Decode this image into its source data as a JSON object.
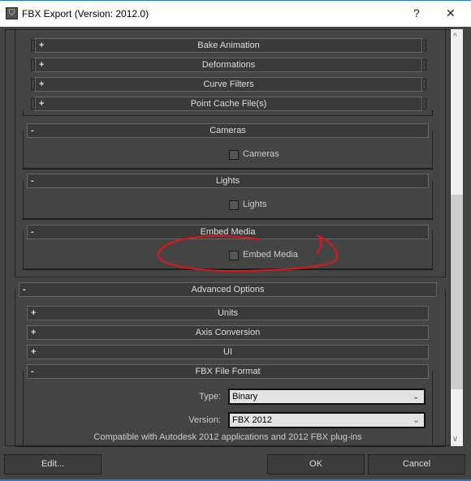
{
  "window": {
    "title": "FBX Export (Version: 2012.0)",
    "help": "?",
    "close": "✕"
  },
  "collapsed_rollouts": [
    {
      "label": "Bake Animation",
      "sign": "+"
    },
    {
      "label": "Deformations",
      "sign": "+"
    },
    {
      "label": "Curve Filters",
      "sign": "+"
    },
    {
      "label": "Point Cache File(s)",
      "sign": "+"
    }
  ],
  "cameras": {
    "header": "Cameras",
    "sign": "-",
    "checkbox_label": "Cameras",
    "checked": false
  },
  "lights": {
    "header": "Lights",
    "sign": "-",
    "checkbox_label": "Lights",
    "checked": false
  },
  "embed": {
    "header": "Embed Media",
    "sign": "-",
    "checkbox_label": "Embed Media",
    "checked": false,
    "annotation_color": "#e0141b"
  },
  "advanced": {
    "header": "Advanced Options",
    "sign": "-",
    "rollouts": [
      {
        "label": "Units",
        "sign": "+"
      },
      {
        "label": "Axis Conversion",
        "sign": "+"
      },
      {
        "label": "UI",
        "sign": "+"
      }
    ],
    "fbx_format": {
      "header": "FBX File Format",
      "sign": "-",
      "type_label": "Type:",
      "type_value": "Binary",
      "version_label": "Version:",
      "version_value": "FBX 2012",
      "compat_text": "Compatible with Autodesk 2012 applications and 2012 FBX plug-ins"
    }
  },
  "scrollbar": {
    "up": "^",
    "down": "v"
  },
  "buttons": {
    "edit": "Edit...",
    "ok": "OK",
    "cancel": "Cancel"
  }
}
